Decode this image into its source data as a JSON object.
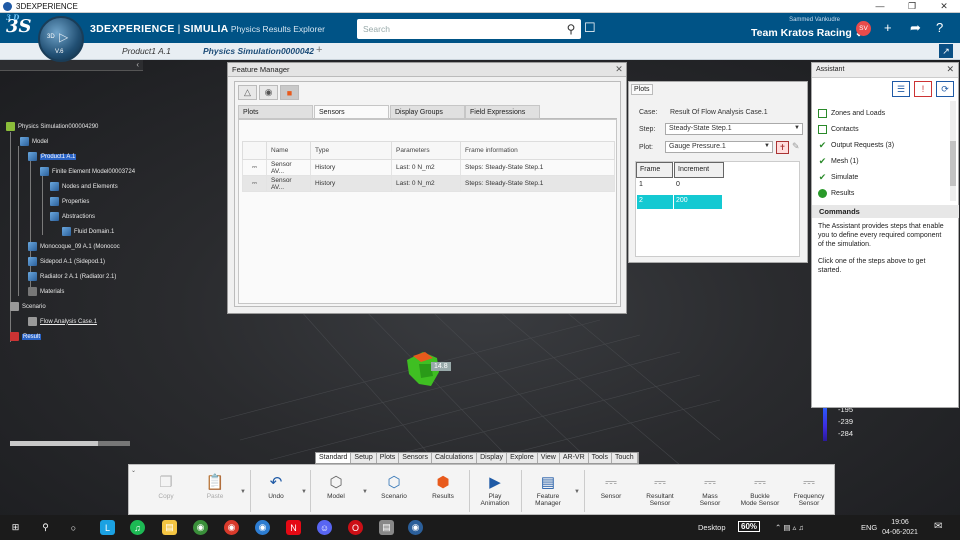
{
  "window": {
    "title": "3DEXPERIENCE",
    "controls": [
      "—",
      "❐",
      "✕"
    ]
  },
  "topbar": {
    "brand": "3DEXPERIENCE",
    "separator": " | ",
    "app": "SIMULIA",
    "app_sub": " Physics Results Explorer",
    "compass_label": "3D",
    "compass_version": "V.6",
    "search_placeholder": "Search",
    "user_name": "Sammed Vankudre",
    "team": "Team Kratos Racing ⌄",
    "avatar_initials": "SV",
    "accent": "#005386"
  },
  "tabs": [
    {
      "label": "Product1 A.1",
      "active": false
    },
    {
      "label": "Physics Simulation0000042",
      "active": true
    }
  ],
  "tree": {
    "nodes": [
      {
        "label": "Physics Simulation000004290",
        "selected": false
      },
      {
        "label": "Model",
        "selected": false
      },
      {
        "label": "Product1 A.1",
        "selected": true
      },
      {
        "label": "Finite Element Model00003724",
        "selected": false
      },
      {
        "label": "Nodes and Elements",
        "selected": false
      },
      {
        "label": "Properties",
        "selected": false
      },
      {
        "label": "Abstractions",
        "selected": false
      },
      {
        "label": "Fluid Domain.1",
        "selected": false
      },
      {
        "label": "Monocoque_09 A.1 (Monococ",
        "selected": false
      },
      {
        "label": "Sidepod A.1 (Sidepod.1)",
        "selected": false
      },
      {
        "label": "Radiator 2 A.1 (Radiator 2.1)",
        "selected": false
      },
      {
        "label": "Materials",
        "selected": false
      },
      {
        "label": "Scenario",
        "selected": false
      },
      {
        "label": "Flow Analysis Case.1",
        "selected": false
      },
      {
        "label": "Result",
        "selected": true
      }
    ]
  },
  "viewport": {
    "part_label": "14.8",
    "legend_values": [
      "-195",
      "-239",
      "-284"
    ]
  },
  "feature_manager": {
    "title": "Feature Manager",
    "subtabs": [
      "Plots",
      "Sensors",
      "Display Groups",
      "Field Expressions"
    ],
    "active_subtab": "Sensors",
    "columns": [
      "Name",
      "Type",
      "Parameters",
      "Frame information"
    ],
    "rows": [
      {
        "name": "Sensor AV...",
        "type": "History",
        "parameters": "Last: 0 N_m2",
        "frame": "Steps: Steady-State Step.1"
      },
      {
        "name": "Sensor AV...",
        "type": "History",
        "parameters": "Last: 0 N_m2",
        "frame": "Steps: Steady-State Step.1"
      }
    ]
  },
  "plots": {
    "title": "Plots",
    "case_label": "Case:",
    "case_value": "Result Of Flow Analysis Case.1",
    "step_label": "Step:",
    "step_value": "Steady-State Step.1",
    "plot_label": "Plot:",
    "plot_value": "Gauge Pressure.1",
    "grid_headers": [
      "Frame",
      "Increment"
    ],
    "grid_rows": [
      {
        "frame": "1",
        "increment": "0",
        "highlight": false
      },
      {
        "frame": "2",
        "increment": "200",
        "highlight": true
      }
    ],
    "highlight_color": "#14c9d2"
  },
  "assistant": {
    "title": "Assistant",
    "steps": [
      {
        "label": "Zones and Loads",
        "state": "box"
      },
      {
        "label": "Contacts",
        "state": "box"
      },
      {
        "label": "Output Requests (3)",
        "state": "check"
      },
      {
        "label": "Mesh (1)",
        "state": "check"
      },
      {
        "label": "Simulate",
        "state": "check"
      },
      {
        "label": "Results",
        "state": "dot"
      }
    ],
    "commands_header": "Commands",
    "commands_text_1": "The Assistant provides steps that enable you to define every required component of the simulation.",
    "commands_text_2": "Click one of the steps above to get started."
  },
  "action_tabs": [
    "Standard",
    "Setup",
    "Plots",
    "Sensors",
    "Calculations",
    "Display",
    "Explore",
    "View",
    "AR-VR",
    "Tools",
    "Touch"
  ],
  "active_action_tab": "Sensors",
  "action_bar": [
    {
      "label": "Copy",
      "icon": "copy-icon",
      "enabled": false
    },
    {
      "label": "Paste",
      "icon": "paste-icon",
      "enabled": false
    },
    {
      "label": "Undo",
      "icon": "undo-icon",
      "enabled": true
    },
    {
      "label": "Model",
      "icon": "model-icon",
      "enabled": true
    },
    {
      "label": "Scenario",
      "icon": "scenario-icon",
      "enabled": true
    },
    {
      "label": "Results",
      "icon": "results-icon",
      "enabled": true
    },
    {
      "label": "Play\nAnimation",
      "icon": "play-animation-icon",
      "enabled": true
    },
    {
      "label": "Feature\nManager",
      "icon": "feature-manager-icon",
      "enabled": true
    },
    {
      "label": "Sensor",
      "icon": "sensor-icon",
      "enabled": true
    },
    {
      "label": "Resultant\nSensor",
      "icon": "resultant-sensor-icon",
      "enabled": true
    },
    {
      "label": "Mass\nSensor",
      "icon": "mass-sensor-icon",
      "enabled": true
    },
    {
      "label": "Buckle\nMode Sensor",
      "icon": "buckle-mode-sensor-icon",
      "enabled": true
    },
    {
      "label": "Frequency\nSensor",
      "icon": "frequency-sensor-icon",
      "enabled": true
    }
  ],
  "taskbar": {
    "desktop_label": "Desktop",
    "battery": "60%",
    "language": "ENG",
    "time": "19:06",
    "date": "04-06-2021"
  }
}
